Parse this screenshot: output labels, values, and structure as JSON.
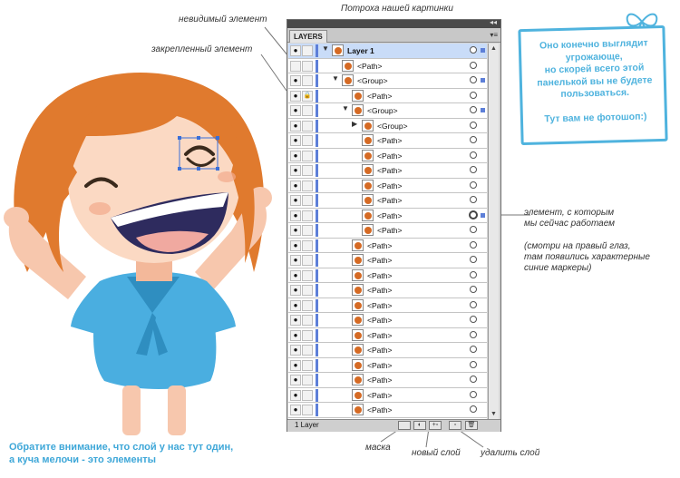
{
  "annotations": {
    "top": "Потроха нашей картинки",
    "invisible": "невидимый элемент",
    "locked": "закрепленный элемент",
    "working1": "элемент, с которым",
    "working2": "мы сейчас работаем",
    "eyes1": "(смотри на правый глаз,",
    "eyes2": "там появились характерные",
    "eyes3": "синие маркеры)",
    "mask": "маска",
    "new_layer": "новый слой",
    "delete_layer": "удалить слой"
  },
  "panel": {
    "tab": "LAYERS",
    "layer_count": "1 Layer",
    "rows": [
      {
        "label": "Layer 1",
        "indent": 0,
        "expand": "open",
        "eye": true,
        "lock": false,
        "selected": true,
        "marker": true,
        "active": false
      },
      {
        "label": "<Path>",
        "indent": 1,
        "expand": "",
        "eye": false,
        "lock": false,
        "selected": false,
        "marker": false,
        "active": false
      },
      {
        "label": "<Group>",
        "indent": 1,
        "expand": "open",
        "eye": true,
        "lock": false,
        "selected": false,
        "marker": true,
        "active": false
      },
      {
        "label": "<Path>",
        "indent": 2,
        "expand": "",
        "eye": true,
        "lock": true,
        "selected": false,
        "marker": false,
        "active": false
      },
      {
        "label": "<Group>",
        "indent": 2,
        "expand": "open",
        "eye": true,
        "lock": false,
        "selected": false,
        "marker": true,
        "active": false
      },
      {
        "label": "<Group>",
        "indent": 3,
        "expand": "closed",
        "eye": true,
        "lock": false,
        "selected": false,
        "marker": false,
        "active": false
      },
      {
        "label": "<Path>",
        "indent": 3,
        "expand": "",
        "eye": true,
        "lock": false,
        "selected": false,
        "marker": false,
        "active": false
      },
      {
        "label": "<Path>",
        "indent": 3,
        "expand": "",
        "eye": true,
        "lock": false,
        "selected": false,
        "marker": false,
        "active": false
      },
      {
        "label": "<Path>",
        "indent": 3,
        "expand": "",
        "eye": true,
        "lock": false,
        "selected": false,
        "marker": false,
        "active": false
      },
      {
        "label": "<Path>",
        "indent": 3,
        "expand": "",
        "eye": true,
        "lock": false,
        "selected": false,
        "marker": false,
        "active": false
      },
      {
        "label": "<Path>",
        "indent": 3,
        "expand": "",
        "eye": true,
        "lock": false,
        "selected": false,
        "marker": false,
        "active": false
      },
      {
        "label": "<Path>",
        "indent": 3,
        "expand": "",
        "eye": true,
        "lock": false,
        "selected": false,
        "marker": true,
        "active": true
      },
      {
        "label": "<Path>",
        "indent": 3,
        "expand": "",
        "eye": true,
        "lock": false,
        "selected": false,
        "marker": false,
        "active": false
      },
      {
        "label": "<Path>",
        "indent": 2,
        "expand": "",
        "eye": true,
        "lock": false,
        "selected": false,
        "marker": false,
        "active": false
      },
      {
        "label": "<Path>",
        "indent": 2,
        "expand": "",
        "eye": true,
        "lock": false,
        "selected": false,
        "marker": false,
        "active": false
      },
      {
        "label": "<Path>",
        "indent": 2,
        "expand": "",
        "eye": true,
        "lock": false,
        "selected": false,
        "marker": false,
        "active": false
      },
      {
        "label": "<Path>",
        "indent": 2,
        "expand": "",
        "eye": true,
        "lock": false,
        "selected": false,
        "marker": false,
        "active": false
      },
      {
        "label": "<Path>",
        "indent": 2,
        "expand": "",
        "eye": true,
        "lock": false,
        "selected": false,
        "marker": false,
        "active": false
      },
      {
        "label": "<Path>",
        "indent": 2,
        "expand": "",
        "eye": true,
        "lock": false,
        "selected": false,
        "marker": false,
        "active": false
      },
      {
        "label": "<Path>",
        "indent": 2,
        "expand": "",
        "eye": true,
        "lock": false,
        "selected": false,
        "marker": false,
        "active": false
      },
      {
        "label": "<Path>",
        "indent": 2,
        "expand": "",
        "eye": true,
        "lock": false,
        "selected": false,
        "marker": false,
        "active": false
      },
      {
        "label": "<Path>",
        "indent": 2,
        "expand": "",
        "eye": true,
        "lock": false,
        "selected": false,
        "marker": false,
        "active": false
      },
      {
        "label": "<Path>",
        "indent": 2,
        "expand": "",
        "eye": true,
        "lock": false,
        "selected": false,
        "marker": false,
        "active": false
      },
      {
        "label": "<Path>",
        "indent": 2,
        "expand": "",
        "eye": true,
        "lock": false,
        "selected": false,
        "marker": false,
        "active": false
      },
      {
        "label": "<Path>",
        "indent": 2,
        "expand": "",
        "eye": true,
        "lock": false,
        "selected": false,
        "marker": false,
        "active": false
      }
    ]
  },
  "note": {
    "line1": "Оно конечно выглядит",
    "line2": "угрожающе,",
    "line3": "но скорей всего этой",
    "line4": "панелькой вы не будете",
    "line5": "пользоваться.",
    "line6": "Тут вам не фотошоп:)"
  },
  "bottom_note": {
    "line1": "Обратите внимание, что слой у нас тут один,",
    "line2": "а куча мелочи - это элементы"
  },
  "colors": {
    "note_blue": "#4fb3de",
    "hair_orange": "#e07a2e",
    "dress_blue": "#4aaee0",
    "selection_blue": "#c9dcf8",
    "marker_blue": "#5d7fd8"
  }
}
